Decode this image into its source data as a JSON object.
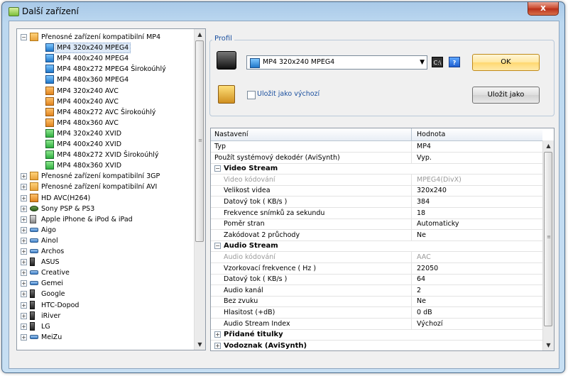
{
  "window": {
    "title": "Další zařízení",
    "close_label": "x"
  },
  "tree": {
    "items": [
      {
        "label": "Přenosné zařízení kompatibilní MP4",
        "level": 0,
        "expander": "−",
        "icon": "folder-icon"
      },
      {
        "label": "MP4 320x240 MPEG4",
        "level": 1,
        "icon": "blue-film-icon",
        "selected": true
      },
      {
        "label": "MP4 400x240 MPEG4",
        "level": 1,
        "icon": "blue-film-icon"
      },
      {
        "label": "MP4 480x272 MPEG4 Širokoúhlý",
        "level": 1,
        "icon": "blue-film-icon"
      },
      {
        "label": "MP4 480x360 MPEG4",
        "level": 1,
        "icon": "blue-film-icon"
      },
      {
        "label": "MP4 320x240 AVC",
        "level": 1,
        "icon": "orange-film-icon"
      },
      {
        "label": "MP4 400x240 AVC",
        "level": 1,
        "icon": "orange-film-icon"
      },
      {
        "label": "MP4 480x272 AVC Širokoúhlý",
        "level": 1,
        "icon": "orange-film-icon"
      },
      {
        "label": "MP4 480x360 AVC",
        "level": 1,
        "icon": "orange-film-icon"
      },
      {
        "label": "MP4 320x240 XVID",
        "level": 1,
        "icon": "green-film-icon"
      },
      {
        "label": "MP4 400x240 XVID",
        "level": 1,
        "icon": "green-film-icon"
      },
      {
        "label": "MP4 480x272 XVID Širokoúhlý",
        "level": 1,
        "icon": "green-film-icon"
      },
      {
        "label": "MP4 480x360 XVID",
        "level": 1,
        "icon": "green-film-icon"
      },
      {
        "label": "Přenosné zařízení kompatibilní 3GP",
        "level": 0,
        "expander": "+",
        "icon": "folder-icon"
      },
      {
        "label": "Přenosné zařízení kompatibilní AVI",
        "level": 0,
        "expander": "+",
        "icon": "folder-icon"
      },
      {
        "label": "HD AVC(H264)",
        "level": 0,
        "expander": "+",
        "icon": "orange-film-icon"
      },
      {
        "label": "Sony PSP & PS3",
        "level": 0,
        "expander": "+",
        "icon": "ps-icon"
      },
      {
        "label": "Apple iPhone & iPod & iPad",
        "level": 0,
        "expander": "+",
        "icon": "apple-icon"
      },
      {
        "label": "Aigo",
        "level": 0,
        "expander": "+",
        "icon": "usb-icon"
      },
      {
        "label": "Ainol",
        "level": 0,
        "expander": "+",
        "icon": "usb-icon"
      },
      {
        "label": "Archos",
        "level": 0,
        "expander": "+",
        "icon": "usb-icon"
      },
      {
        "label": "ASUS",
        "level": 0,
        "expander": "+",
        "icon": "phone-icon"
      },
      {
        "label": "Creative",
        "level": 0,
        "expander": "+",
        "icon": "usb-icon"
      },
      {
        "label": "Gemei",
        "level": 0,
        "expander": "+",
        "icon": "usb-icon"
      },
      {
        "label": "Google",
        "level": 0,
        "expander": "+",
        "icon": "phone-icon"
      },
      {
        "label": "HTC-Dopod",
        "level": 0,
        "expander": "+",
        "icon": "phone-icon"
      },
      {
        "label": "iRiver",
        "level": 0,
        "expander": "+",
        "icon": "phone-icon"
      },
      {
        "label": "LG",
        "level": 0,
        "expander": "+",
        "icon": "phone-icon"
      },
      {
        "label": "MeiZu",
        "level": 0,
        "expander": "+",
        "icon": "usb-icon"
      }
    ]
  },
  "profile": {
    "group_label": "Profil",
    "selected_profile": "MP4 320x240 MPEG4",
    "ok_label": "OK",
    "save_default_label": "Uložit jako výchozí",
    "save_as_label": "Uložit jako",
    "cmd_label": "C:\\",
    "help_label": "?"
  },
  "grid": {
    "col_name": "Nastavení",
    "col_value": "Hodnota",
    "rows": [
      {
        "type": "prop",
        "name": "Typ",
        "value": "MP4"
      },
      {
        "type": "prop",
        "name": "Použít systémový dekodér (AviSynth)",
        "value": "Vyp."
      },
      {
        "type": "cat",
        "name": "Video Stream",
        "expander": "−"
      },
      {
        "type": "sub",
        "name": "Video kódování",
        "value": "MPEG4(DivX)",
        "disabled": true
      },
      {
        "type": "sub",
        "name": "Velikost videa",
        "value": "320x240"
      },
      {
        "type": "sub",
        "name": "Datový tok ( KB/s )",
        "value": "384"
      },
      {
        "type": "sub",
        "name": "Frekvence snímků za sekundu",
        "value": "18"
      },
      {
        "type": "sub",
        "name": "Poměr stran",
        "value": "Automaticky"
      },
      {
        "type": "sub",
        "name": "Zakódovat 2 průchody",
        "value": "Ne"
      },
      {
        "type": "cat",
        "name": "Audio Stream",
        "expander": "−"
      },
      {
        "type": "sub",
        "name": "Audio kódování",
        "value": "AAC",
        "disabled": true
      },
      {
        "type": "sub",
        "name": "Vzorkovací frekvence ( Hz )",
        "value": "22050"
      },
      {
        "type": "sub",
        "name": "Datový tok ( KB/s )",
        "value": "64"
      },
      {
        "type": "sub",
        "name": "Audio kanál",
        "value": "2"
      },
      {
        "type": "sub",
        "name": "Bez zvuku",
        "value": "Ne"
      },
      {
        "type": "sub",
        "name": "Hlasitost (+dB)",
        "value": "0 dB"
      },
      {
        "type": "sub",
        "name": "Audio Stream Index",
        "value": "Výchozí"
      },
      {
        "type": "cat",
        "name": "Přidané titulky",
        "expander": "+"
      },
      {
        "type": "cat",
        "name": "Vodoznak (AviSynth)",
        "expander": "+"
      }
    ]
  }
}
